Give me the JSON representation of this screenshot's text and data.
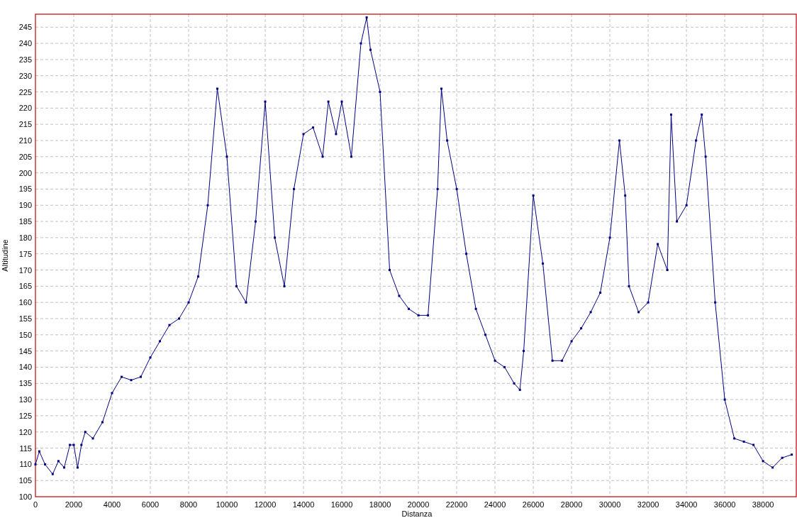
{
  "chart": {
    "chart_data": {
      "type": "line",
      "grid": true,
      "xlabel": "Distanza",
      "ylabel": "Altitudine",
      "xlim": [
        0,
        39700
      ],
      "ylim": [
        100,
        249
      ],
      "xticks": [
        0,
        2000,
        4000,
        6000,
        8000,
        10000,
        12000,
        14000,
        16000,
        18000,
        20000,
        22000,
        24000,
        26000,
        28000,
        30000,
        32000,
        34000,
        36000,
        38000
      ],
      "yticks": [
        100,
        105,
        110,
        115,
        120,
        125,
        130,
        135,
        140,
        145,
        150,
        155,
        160,
        165,
        170,
        175,
        180,
        185,
        190,
        195,
        200,
        205,
        210,
        215,
        220,
        225,
        230,
        235,
        240,
        245
      ],
      "x": [
        0,
        200,
        500,
        900,
        1200,
        1500,
        1800,
        2000,
        2200,
        2400,
        2600,
        3000,
        3500,
        4000,
        4500,
        5000,
        5500,
        6000,
        6500,
        7000,
        7500,
        8000,
        8500,
        9000,
        9500,
        10000,
        10500,
        11000,
        11500,
        12000,
        12500,
        13000,
        13500,
        14000,
        14500,
        15000,
        15300,
        15700,
        16000,
        16500,
        17000,
        17300,
        17500,
        18000,
        18500,
        19000,
        19500,
        20000,
        20500,
        21000,
        21200,
        21500,
        22000,
        22500,
        23000,
        23500,
        24000,
        24500,
        25000,
        25300,
        25500,
        26000,
        26500,
        27000,
        27500,
        28000,
        28500,
        29000,
        29500,
        30000,
        30500,
        30800,
        31000,
        31500,
        32000,
        32500,
        33000,
        33200,
        33500,
        34000,
        34500,
        34800,
        35000,
        35500,
        36000,
        36500,
        37000,
        37500,
        38000,
        38500,
        39000,
        39500
      ],
      "series": [
        {
          "color": "#000080",
          "values": [
            110,
            114,
            110,
            107,
            111,
            109,
            116,
            116,
            109,
            116,
            120,
            118,
            123,
            132,
            137,
            136,
            137,
            143,
            148,
            153,
            155,
            160,
            168,
            190,
            226,
            205,
            165,
            160,
            185,
            222,
            180,
            165,
            195,
            212,
            214,
            205,
            222,
            212,
            222,
            205,
            240,
            248,
            238,
            225,
            170,
            162,
            158,
            156,
            156,
            195,
            226,
            210,
            195,
            175,
            158,
            150,
            142,
            140,
            135,
            133,
            145,
            193,
            172,
            142,
            142,
            148,
            152,
            157,
            163,
            180,
            210,
            193,
            165,
            157,
            160,
            178,
            170,
            218,
            185,
            190,
            210,
            218,
            205,
            160,
            130,
            118,
            117,
            116,
            111,
            109,
            112,
            113
          ]
        }
      ]
    }
  }
}
